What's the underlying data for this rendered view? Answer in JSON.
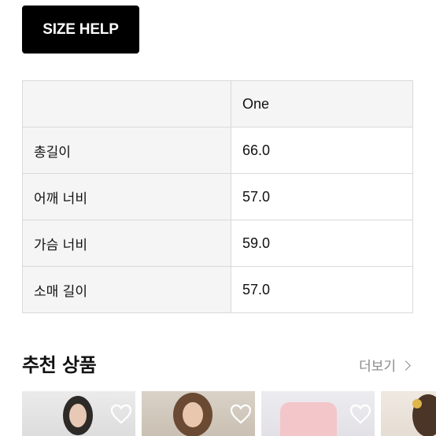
{
  "size_help": {
    "label": "SIZE HELP"
  },
  "size_table": {
    "column_header": "One",
    "rows": [
      {
        "label": "총길이",
        "value": "66.0"
      },
      {
        "label": "어깨 너비",
        "value": "57.0"
      },
      {
        "label": "가슴 너비",
        "value": "59.0"
      },
      {
        "label": "소매 길이",
        "value": "57.0"
      }
    ]
  },
  "recommended": {
    "title": "추천 상품",
    "more_label": "더보기",
    "more_icon": "chevron-right-icon",
    "products": [
      {
        "image": "product-photo-1",
        "wishlist_icon": "heart-icon"
      },
      {
        "image": "product-photo-2",
        "wishlist_icon": "heart-icon"
      },
      {
        "image": "product-photo-3",
        "wishlist_icon": "heart-icon"
      },
      {
        "image": "product-photo-4",
        "wishlist_icon": "heart-icon"
      }
    ]
  },
  "colors": {
    "button_bg": "#000000",
    "table_border": "#d9d9d9",
    "header_bg": "#f5f5f5",
    "muted_text": "#8a8a8a"
  }
}
